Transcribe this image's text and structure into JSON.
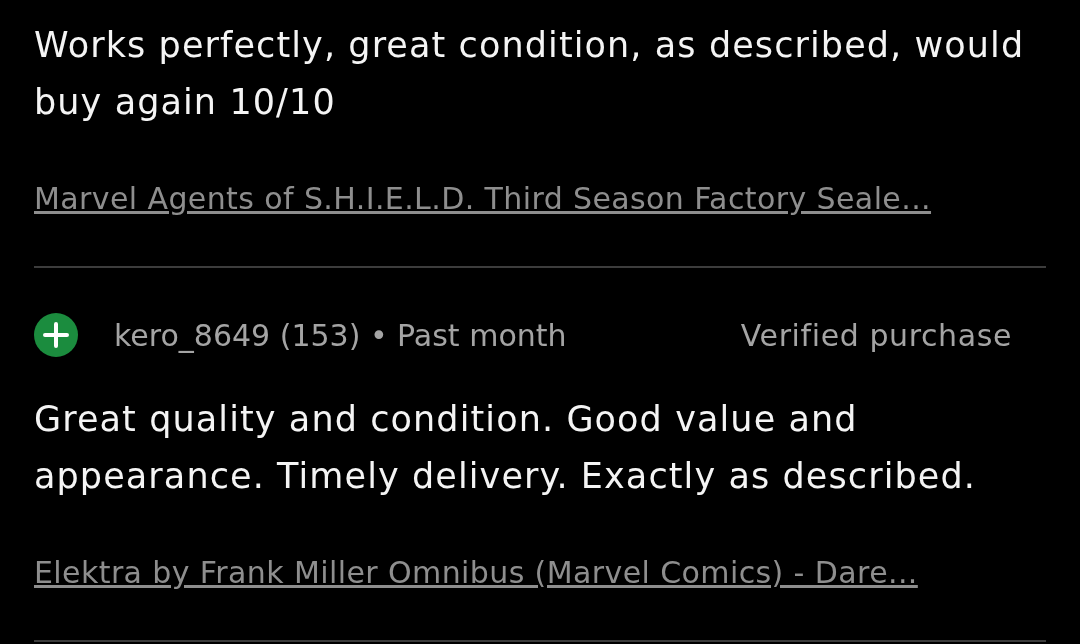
{
  "reviews": [
    {
      "comment": "Works perfectly, great condition, as described, would buy again 10/10",
      "item_link": "Marvel Agents of S.H.I.E.L.D. Third Season Factory Seale..."
    },
    {
      "kind": "positive",
      "reviewer": "kero_8649 (153) • Past month",
      "verified_label": "Verified purchase",
      "comment": "Great quality and condition. Good value and appearance. Timely delivery. Exactly as described.",
      "item_link": "Elektra by Frank Miller Omnibus (Marvel Comics) - Dare..."
    }
  ]
}
